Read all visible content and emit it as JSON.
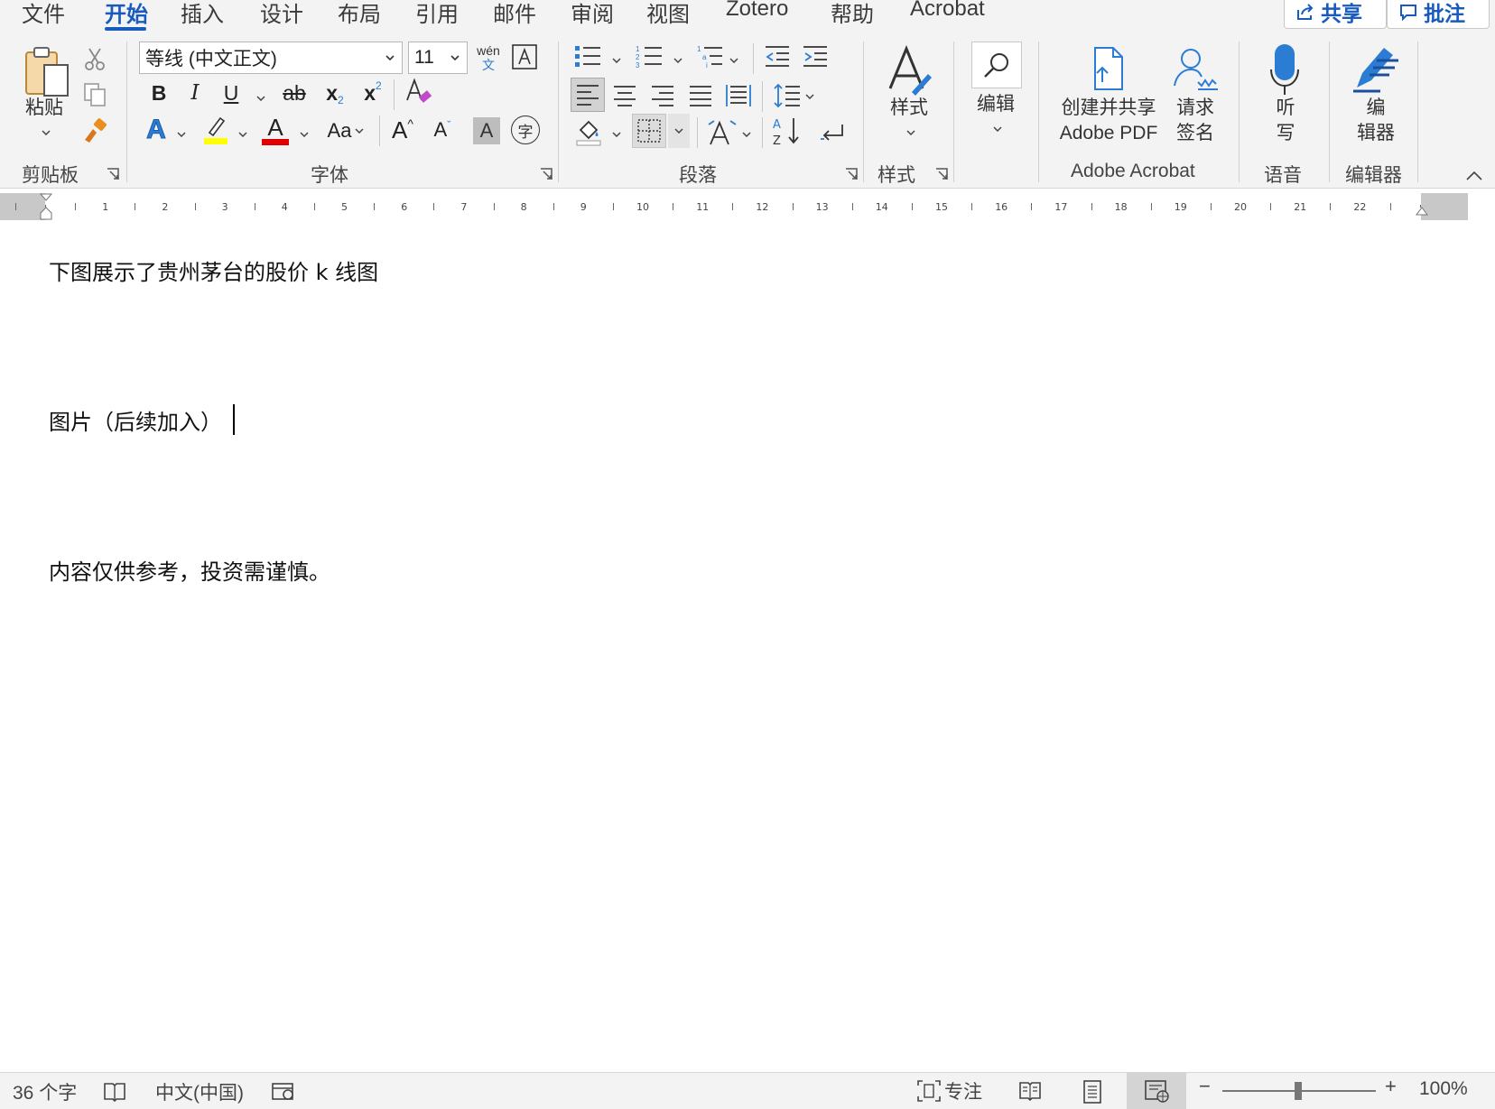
{
  "tabs": [
    "文件",
    "开始",
    "插入",
    "设计",
    "布局",
    "引用",
    "邮件",
    "审阅",
    "视图",
    "Zotero",
    "帮助",
    "Acrobat"
  ],
  "active_tab": "开始",
  "top_buttons": {
    "share": "共享",
    "comments": "批注"
  },
  "clipboard": {
    "paste_label": "粘贴",
    "group_label": "剪贴板"
  },
  "font": {
    "font_name": "等线 (中文正文)",
    "font_size": "11",
    "phonetic_top": "wén",
    "phonetic_bottom": "文",
    "bold": "B",
    "italic": "I",
    "underline": "U",
    "strike": "ab",
    "subscript": "x",
    "superscript": "x",
    "font_color_letter": "A",
    "change_case": "Aa",
    "grow_font": "A",
    "shrink_font": "A",
    "char_shading": "A",
    "enclose_char": "字",
    "group_label": "字体"
  },
  "paragraph": {
    "group_label": "段落"
  },
  "styles": {
    "button_label": "样式",
    "group_label": "样式"
  },
  "editing": {
    "button_label": "编辑"
  },
  "acrobat": {
    "create_share_line1": "创建并共享",
    "create_share_line2": "Adobe PDF",
    "request_sign_line1": "请求",
    "request_sign_line2": "签名",
    "group_label": "Adobe Acrobat"
  },
  "voice": {
    "dictate_line1": "听",
    "dictate_line2": "写",
    "group_label": "语音"
  },
  "editor": {
    "editor_line1": "编",
    "editor_line2": "辑器",
    "group_label": "编辑器"
  },
  "document": {
    "paragraphs": [
      "下图展示了贵州茅台的股价 k 线图",
      "图片（后续加入）",
      "内容仅供参考，投资需谨慎。"
    ]
  },
  "status_bar": {
    "word_count": "36 个字",
    "language": "中文(中国)",
    "focus": "专注",
    "zoom": "100%"
  },
  "colors": {
    "accent": "#185abd",
    "highlight": "#ffff00",
    "font_color": "#e00000",
    "ribbon_bg": "#f3f3f3"
  }
}
